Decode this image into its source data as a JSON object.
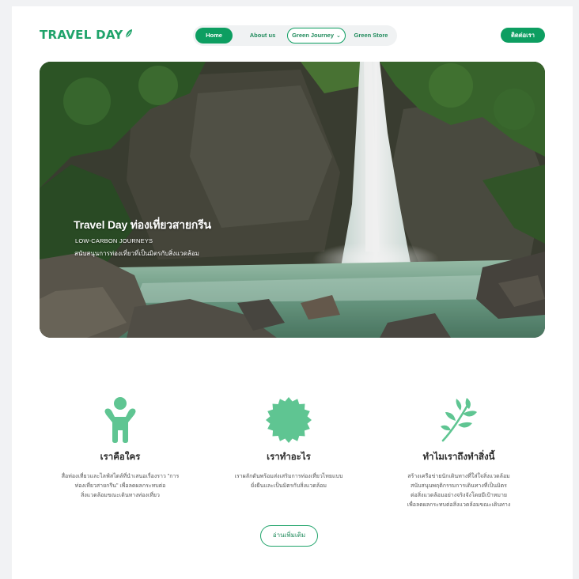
{
  "brand": {
    "logo_text": "TRAVEL DAY",
    "color": "#1fa36a"
  },
  "nav": {
    "items": [
      {
        "label": "Home",
        "active": true
      },
      {
        "label": "About us"
      },
      {
        "label": "Green Journey",
        "dropdown": true
      },
      {
        "label": "Green Store"
      }
    ],
    "contact_label": "ติดต่อเรา"
  },
  "hero": {
    "title": "Travel Day ท่องเที่ยวสายกรีน",
    "subtitle": "LOW-CARBON JOURNEYS",
    "description": "สนับสนุนการท่องเที่ยวที่เป็นมิตรกับสิ่งแวดล้อม",
    "image": "waterfall-forest-photo"
  },
  "features": [
    {
      "icon": "person-icon",
      "title": "เราคือใคร",
      "lines": [
        "สื่อท่องเที่ยวและไลฟ์สไตล์ที่นำเสนอเรื่องราว \"การ",
        "ท่องเที่ยวสายกรีน\" เพื่อลดผลกระทบต่อ",
        "สิ่งแวดล้อมขณะเดินทางท่องเที่ยว"
      ]
    },
    {
      "icon": "badge-icon",
      "title": "เราทำอะไร",
      "lines": [
        "เราผลักดันพร้อมส่งเสริมการท่องเที่ยวไทยแบบ",
        "ยั่งยืนและเป็นมิตรกับสิ่งแวดล้อม"
      ]
    },
    {
      "icon": "leaf-icon",
      "title": "ทำไมเราถึงทำสิ่งนี้",
      "lines": [
        "สร้างเครือข่ายนักเดินทางที่ใส่ใจสิ่งแวดล้อม",
        "สนับสนุนพฤติกรรมการเดินทางที่เป็นมิตร",
        "ต่อสิ่งแวดล้อมอย่างจริงจังโดยมีเป้าหมาย",
        "เพื่อลดผลกระทบต่อสิ่งแวดล้อมขณะเดินทาง"
      ]
    }
  ],
  "read_more_label": "อ่านเพิ่มเติม",
  "colors": {
    "primary": "#0d9e61",
    "icon_green": "#5fc592",
    "page_bg": "#f1f2f4"
  }
}
